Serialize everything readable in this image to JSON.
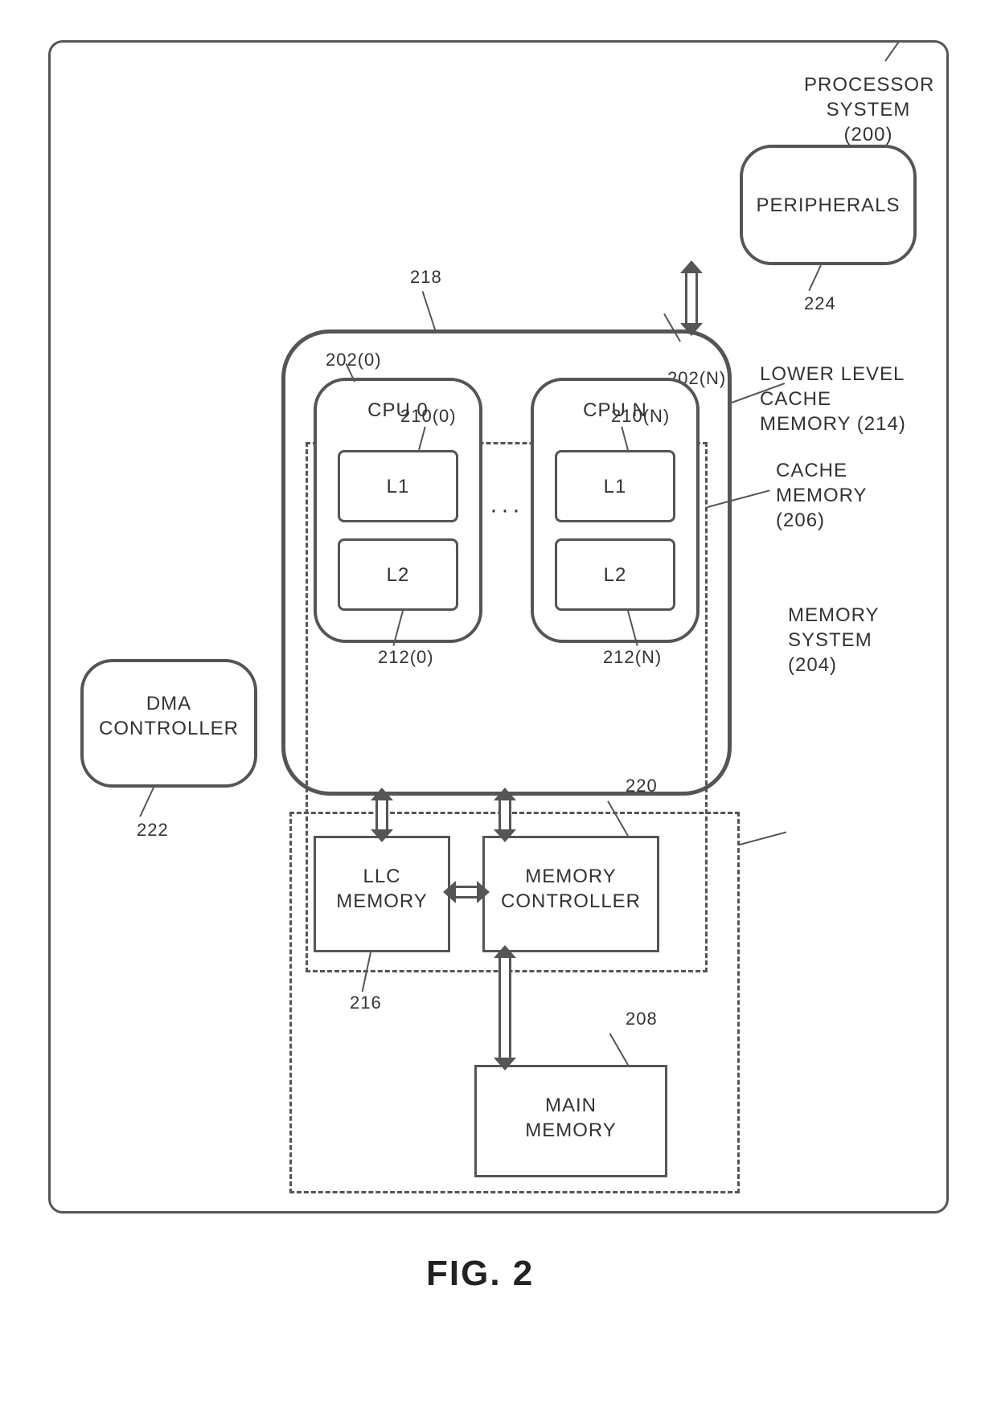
{
  "figure_label": "FIG. 2",
  "outer": {
    "title": "PROCESSOR\nSYSTEM (200)"
  },
  "dma": {
    "label": "DMA\nCONTROLLER",
    "ref": "222"
  },
  "peripherals": {
    "label": "PERIPHERALS",
    "ref": "224"
  },
  "bus_ref": "218",
  "lower_level_cache": "LOWER LEVEL CACHE\nMEMORY (214)",
  "cache_memory": "CACHE\nMEMORY\n(206)",
  "memory_system": "MEMORY\nSYSTEM\n(204)",
  "cpu0": {
    "label": "CPU 0",
    "l1": "L1",
    "l2": "L2",
    "ref_cpu": "202(0)",
    "ref_l1": "210(0)",
    "ref_l2": "212(0)"
  },
  "cpuN": {
    "label": "CPU N",
    "l1": "L1",
    "l2": "L2",
    "ref_cpu": "202(N)",
    "ref_l1": "210(N)",
    "ref_l2": "212(N)"
  },
  "ref_202N_top": "202(N)",
  "llc": {
    "label": "LLC\nMEMORY",
    "ref": "216"
  },
  "memctl": {
    "label": "MEMORY\nCONTROLLER",
    "ref": "220"
  },
  "main_mem": {
    "label": "MAIN\nMEMORY",
    "ref": "208"
  }
}
